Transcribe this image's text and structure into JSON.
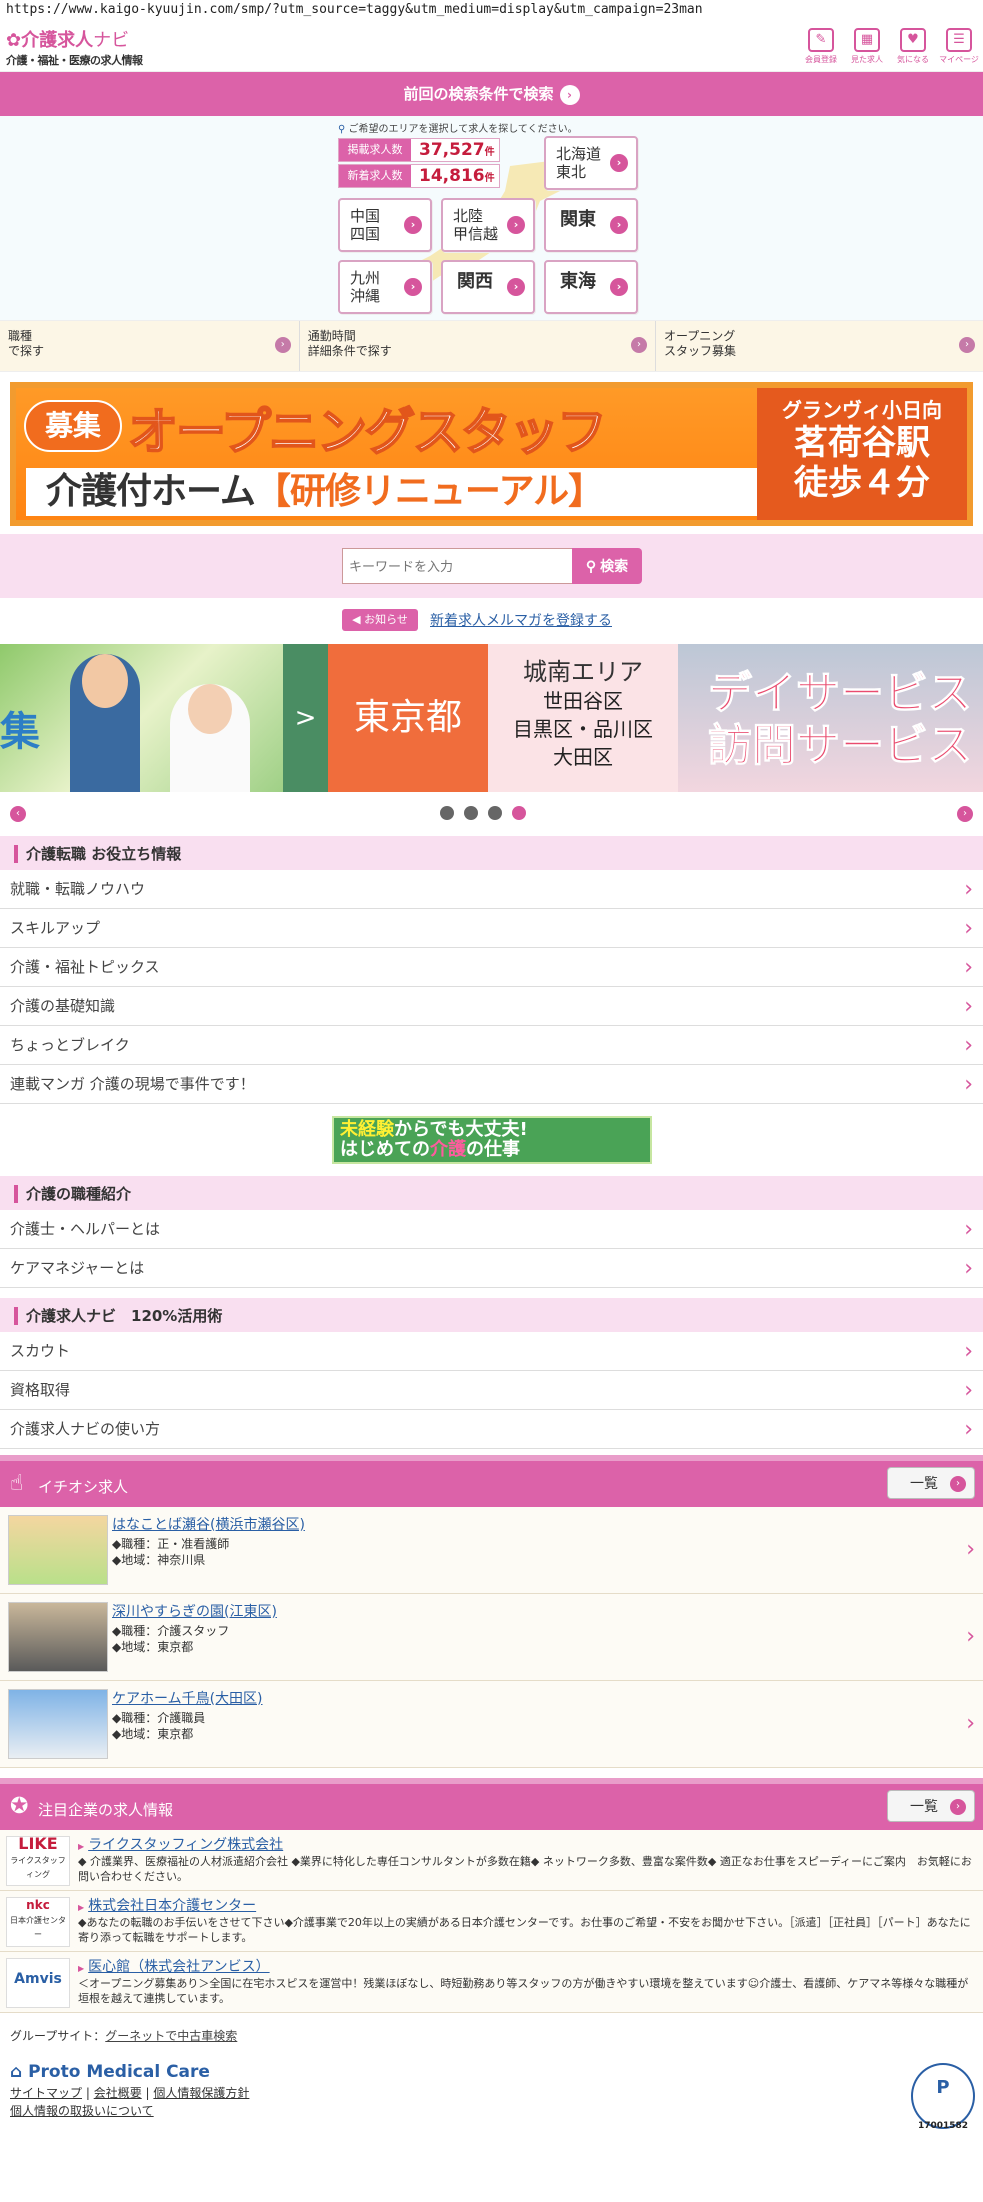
{
  "url": "https://www.kaigo-kyuujin.com/smp/?utm_source=taggy&utm_medium=display&utm_campaign=23man",
  "header": {
    "logo_main": "介護求人",
    "logo_sub": "ナビ",
    "logo_tagline": "介護・福祉・医療の求人情報",
    "icons": [
      {
        "label": "会員登録",
        "icon": "pencil-icon"
      },
      {
        "label": "見た求人",
        "icon": "calendar-icon"
      },
      {
        "label": "気になる",
        "icon": "heart-icon"
      },
      {
        "label": "マイページ",
        "icon": "mypage-icon"
      }
    ]
  },
  "prev_search": {
    "label": "前回の検索条件で検索"
  },
  "area": {
    "note": "ご希望のエリアを選択して求人を探してください。",
    "stats": [
      {
        "label": "掲載求人数",
        "value": "37,527",
        "unit": "件"
      },
      {
        "label": "新着求人数",
        "value": "14,816",
        "unit": "件"
      }
    ],
    "buttons": [
      {
        "label1": "北海道",
        "label2": "東北"
      },
      {
        "label1": "中国",
        "label2": "四国"
      },
      {
        "label1": "北陸",
        "label2": "甲信越"
      },
      {
        "label1": "関東",
        "label2": ""
      },
      {
        "label1": "九州",
        "label2": "沖縄"
      },
      {
        "label1": "関西",
        "label2": ""
      },
      {
        "label1": "東海",
        "label2": ""
      }
    ]
  },
  "sub_nav": [
    {
      "line1": "職種",
      "line2": "で探す"
    },
    {
      "line1": "通勤時間",
      "line2": "詳細条件で探す"
    },
    {
      "line1": "オープニング",
      "line2": "スタッフ募集"
    }
  ],
  "banner": {
    "badge": "募集",
    "title": "オープニングスタッフ",
    "subtitle_a": "介護付ホーム",
    "subtitle_b": "【研修リニューアル】",
    "side_small": "グランヴィ小日向",
    "side_big1": "茗荷谷駅",
    "side_big2": "徒歩４分"
  },
  "search": {
    "placeholder": "キーワードを入力",
    "button": "検索"
  },
  "notice": {
    "badge": "お知らせ",
    "link": "新着求人メルマガを登録する"
  },
  "carousel": {
    "left_kanji": "集",
    "arrow": ">",
    "tokyo": "東京都",
    "area_title": "城南エリア",
    "area_line1": "世田谷区",
    "area_line2": "目黒区・品川区",
    "area_line3": "大田区",
    "service1": "デイサービス",
    "service2": "訪問サービス",
    "dots": 4,
    "active_dot": 3
  },
  "sections": {
    "tips": {
      "title": "介護転職 お役立ち情報",
      "items": [
        "就職・転職ノウハウ",
        "スキルアップ",
        "介護・福祉トピックス",
        "介護の基礎知識",
        "ちょっとブレイク",
        "連載マンガ 介護の現場で事件です！"
      ]
    },
    "promo": {
      "a": "未経験",
      "b": "からでも大丈夫!",
      "c": "はじめての",
      "d": "介護",
      "e": "の仕事"
    },
    "jobtypes": {
      "title": "介護の職種紹介",
      "items": [
        "介護士・ヘルパーとは",
        "ケアマネジャーとは"
      ]
    },
    "usage": {
      "title": "介護求人ナビ　120%活用術",
      "items": [
        "スカウト",
        "資格取得",
        "介護求人ナビの使い方"
      ]
    }
  },
  "pickup": {
    "title": "イチオシ求人",
    "all_label": "一覧",
    "items": [
      {
        "name": "はなことば瀬谷(横浜市瀬谷区)",
        "job": "◆職種：正・准看護師",
        "area": "◆地域：神奈川県"
      },
      {
        "name": "深川やすらぎの園(江東区)",
        "job": "◆職種：介護スタッフ",
        "area": "◆地域：東京都"
      },
      {
        "name": "ケアホーム千鳥(大田区)",
        "job": "◆職種：介護職員",
        "area": "◆地域：東京都"
      }
    ]
  },
  "companies": {
    "title": "注目企業の求人情報",
    "all_label": "一覧",
    "items": [
      {
        "logo": "LIKE",
        "logo_sub": "ライクスタッフィング",
        "name": "ライクスタッフィング株式会社",
        "desc": "◆ 介護業界、医療福祉の人材派遣紹介会社 ◆業界に特化した専任コンサルタントが多数在籍◆ ネットワーク多数、豊富な案件数◆ 適正なお仕事をスピーディーにご案内　お気軽にお問い合わせください。"
      },
      {
        "logo": "nkc",
        "logo_sub": "日本介護センター",
        "name": "株式会社日本介護センター",
        "desc": "◆あなたの転職のお手伝いをさせて下さい◆介護事業で20年以上の実績がある日本介護センターです。お仕事のご希望・不安をお聞かせ下さい。［派遣］［正社員］［パート］あなたに寄り添って転職をサポートします。"
      },
      {
        "logo": "Amvis",
        "logo_sub": "",
        "name": "医心館（株式会社アンビス）",
        "desc": "＜オープニング募集あり＞全国に在宅ホスピスを運営中！残業ほぼなし、時短勤務あり等スタッフの方が働きやすい環境を整えています☺介護士、看護師、ケアマネ等様々な職種が垣根を越えて連携しています。"
      }
    ]
  },
  "footer": {
    "group_label": "グループサイト：",
    "group_link": "グーネットで中古車検索",
    "brand": "Proto Medical Care",
    "links": [
      "サイトマップ",
      "会社概要",
      "個人情報保護方針",
      "個人情報の取扱いについて"
    ],
    "pmark": "P",
    "pmark_no": "17001582"
  },
  "colors": {
    "accent": "#dc62a9",
    "link": "#2a5fa5",
    "price": "#c51c3c"
  }
}
